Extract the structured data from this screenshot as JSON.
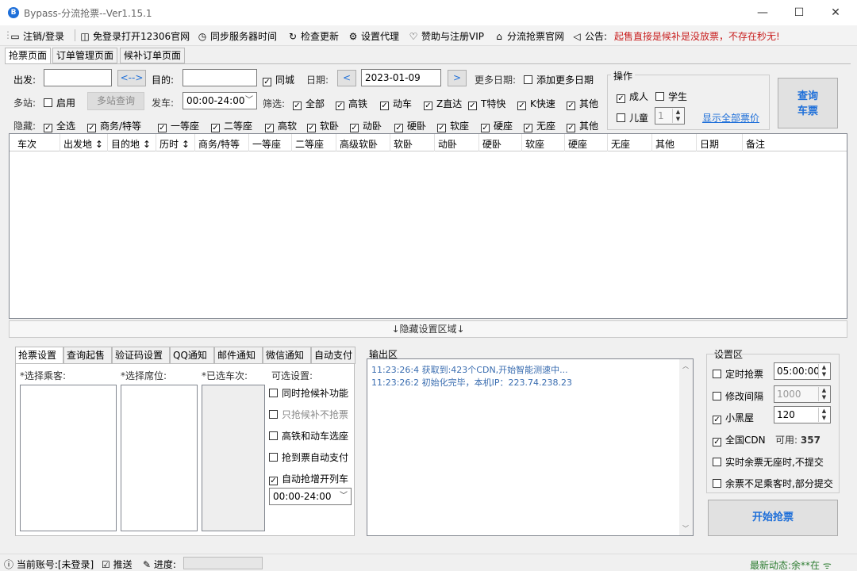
{
  "window": {
    "title": "Bypass-分流抢票--Ver1.15.1",
    "minimize": "—",
    "maximize": "☐",
    "close": "✕"
  },
  "toolbar": {
    "login": "注销/登录",
    "open12306": "免登录打开12306官网",
    "sync_time": "同步服务器时间",
    "check_update": "检查更新",
    "proxy": "设置代理",
    "sponsor": "赞助与注册VIP",
    "site": "分流抢票官网",
    "notice_label": "公告:",
    "notice_text": "起售直接是候补是没放票，不存在秒无!"
  },
  "tabs": [
    "抢票页面",
    "订单管理页面",
    "候补订单页面"
  ],
  "query": {
    "from_label": "出发:",
    "from_value": "",
    "swap": "<-->",
    "to_label": "目的:",
    "to_value": "",
    "same_city": "同城",
    "date_label": "日期:",
    "date_value": "2023-01-09",
    "prev": "<",
    "next": ">",
    "more_dates_label": "更多日期:",
    "add_more_dates": "添加更多日期",
    "multi_label": "多站:",
    "multi_enable": "启用",
    "multi_query": "多站查询",
    "depart_label": "发车:",
    "depart_value": "00:00-24:00",
    "filter_label": "筛选:",
    "filters": [
      "全部",
      "高铁",
      "动车",
      "Z直达",
      "T特快",
      "K快速",
      "其他"
    ],
    "hide_label": "隐藏:",
    "hides": [
      "全选",
      "商务/特等",
      "一等座",
      "二等座",
      "高软",
      "软卧",
      "动卧",
      "硬卧",
      "软座",
      "硬座",
      "无座",
      "其他"
    ]
  },
  "operation": {
    "title": "操作",
    "adult": "成人",
    "student": "学生",
    "child": "儿童",
    "child_count": "1",
    "show_all_prices": "显示全部票价",
    "query_btn_line1": "查询",
    "query_btn_line2": "车票"
  },
  "grid": {
    "columns": [
      "车次",
      "出发地 ↕",
      "目的地 ↕",
      "历时 ↕",
      "商务/特等",
      "一等座",
      "二等座",
      "高级软卧",
      "软卧",
      "动卧",
      "硬卧",
      "软座",
      "硬座",
      "无座",
      "其他",
      "日期",
      "备注"
    ]
  },
  "hide_area": "↓隐藏设置区域↓",
  "bottom_tabs": [
    "抢票设置",
    "查询起售",
    "验证码设置",
    "QQ通知",
    "邮件通知",
    "微信通知",
    "自动支付"
  ],
  "ticket_settings": {
    "passengers": "*选择乘客:",
    "seats": "*选择席位:",
    "trains": "*已选车次:",
    "options_title": "可选设置:",
    "options": [
      {
        "label": "同时抢候补功能",
        "checked": false,
        "enabled": true
      },
      {
        "label": "只抢候补不抢票",
        "checked": false,
        "enabled": false
      },
      {
        "label": "高铁和动车选座",
        "checked": false,
        "enabled": true
      },
      {
        "label": "抢到票自动支付",
        "checked": false,
        "enabled": true
      },
      {
        "label": "自动抢增开列车",
        "checked": true,
        "enabled": true
      }
    ],
    "time_range": "00:00-24:00"
  },
  "output": {
    "title": "输出区",
    "lines": [
      "11:23:26:4   获取到:423个CDN,开始智能测速中...",
      "11:23:26:2   初始化完毕，本机IP：223.74.238.23"
    ]
  },
  "settings": {
    "title": "设置区",
    "timed": "定时抢票",
    "timed_value": "05:00:00",
    "interval": "修改间隔",
    "interval_value": "1000",
    "blackroom": "小黑屋",
    "blackroom_value": "120",
    "cdn": "全国CDN",
    "cdn_avail_label": "可用:",
    "cdn_avail": "357",
    "realtime": "实时余票无座时,不提交",
    "partial": "余票不足乘客时,部分提交",
    "start": "开始抢票"
  },
  "status": {
    "account": "当前账号:[未登录]",
    "push": "推送",
    "progress": "进度:",
    "news_label": "最新动态:",
    "news": "余**在"
  }
}
